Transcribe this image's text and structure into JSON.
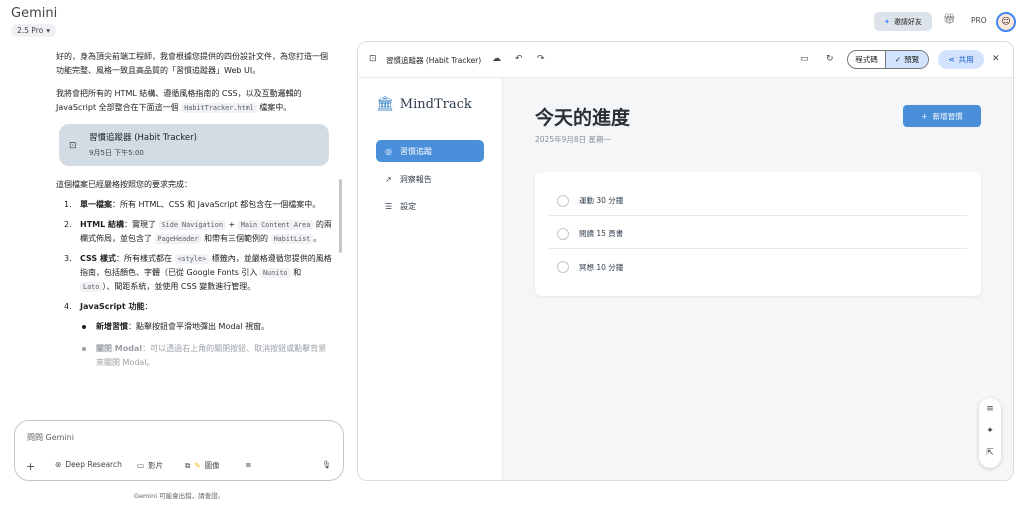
{
  "header": {
    "app_title": "Gemini",
    "model": "2.5 Pro",
    "invite_label": "邀請好友",
    "pro_label": "PRO"
  },
  "chat": {
    "intro_1": "好的，身為頂尖前端工程師，我會根據您提供的四份設計文件，為您打造一個功能完整、風格一致且高品質的「習慣追蹤器」Web UI。",
    "intro_2a": "我將會把所有的 HTML 結構、遵循風格指南的 CSS，以及互動邏輯的 JavaScript 全部整合在下面這一個 ",
    "intro_2_code": "HabitTracker.html",
    "intro_2b": " 檔案中。",
    "file_card": {
      "title": "習慣追蹤器 (Habit Tracker)",
      "time": "9月5日 下午5:00"
    },
    "req_intro": "這個檔案已經嚴格按照您的要求完成：",
    "req1": {
      "num": "1.",
      "title": "單一檔案",
      "text": "：所有 HTML、CSS 和 JavaScript 都包含在一個檔案中。"
    },
    "req2": {
      "num": "2.",
      "title": "HTML 結構",
      "t1": "：實現了 ",
      "c1": "Side Navigation",
      "t2": " + ",
      "c2": "Main Content Area",
      "t3": " 的兩欄式佈局，並包含了 ",
      "c3": "PageHeader",
      "t4": " 和帶有三個範例的 ",
      "c4": "HabitList",
      "t5": "。"
    },
    "req3": {
      "num": "3.",
      "title": "CSS 樣式",
      "t1": "：所有樣式都在 ",
      "c1": "<style>",
      "t2": " 標籤內，並嚴格遵循您提供的風格指南，包括顏色、字體（已從 Google Fonts 引入 ",
      "c2": "Nunito",
      "t3": " 和 ",
      "c3": "Lato",
      "t4": "）、間距系統，並使用 CSS 變數進行管理。"
    },
    "req4": {
      "num": "4.",
      "title": "JavaScript 功能",
      "t1": "："
    },
    "js_items": [
      {
        "title": "新增習慣",
        "text": "：點擊按鈕會平滑地彈出 Modal 視窗。"
      },
      {
        "title": "關閉 Modal",
        "text": "：可以透過右上角的關閉按鈕、取消按鈕或點擊背景來關閉 Modal。"
      }
    ]
  },
  "input": {
    "placeholder": "問問 Gemini",
    "tools": [
      "Deep Research",
      "影片",
      "圖像"
    ]
  },
  "footer_note": "Gemini 可能會出錯，請查證。",
  "canvas": {
    "title": "習慣追蹤器 (Habit Tracker)",
    "code_label": "程式碼",
    "preview_label": "預覽",
    "share_label": "共用"
  },
  "app": {
    "brand": "MindTrack",
    "nav": [
      "習慣追蹤",
      "洞察報告",
      "設定"
    ],
    "page_title": "今天的進度",
    "date": "2025年9月8日 星期一",
    "add_button": "新增習慣",
    "habits": [
      "運動 30 分鐘",
      "閱讀 15 頁書",
      "冥想 10 分鐘"
    ]
  },
  "colors": {
    "accent": "#4a8fd9",
    "chip_bg": "#d3e3fd",
    "file_card_bg": "#d3dbe5"
  }
}
